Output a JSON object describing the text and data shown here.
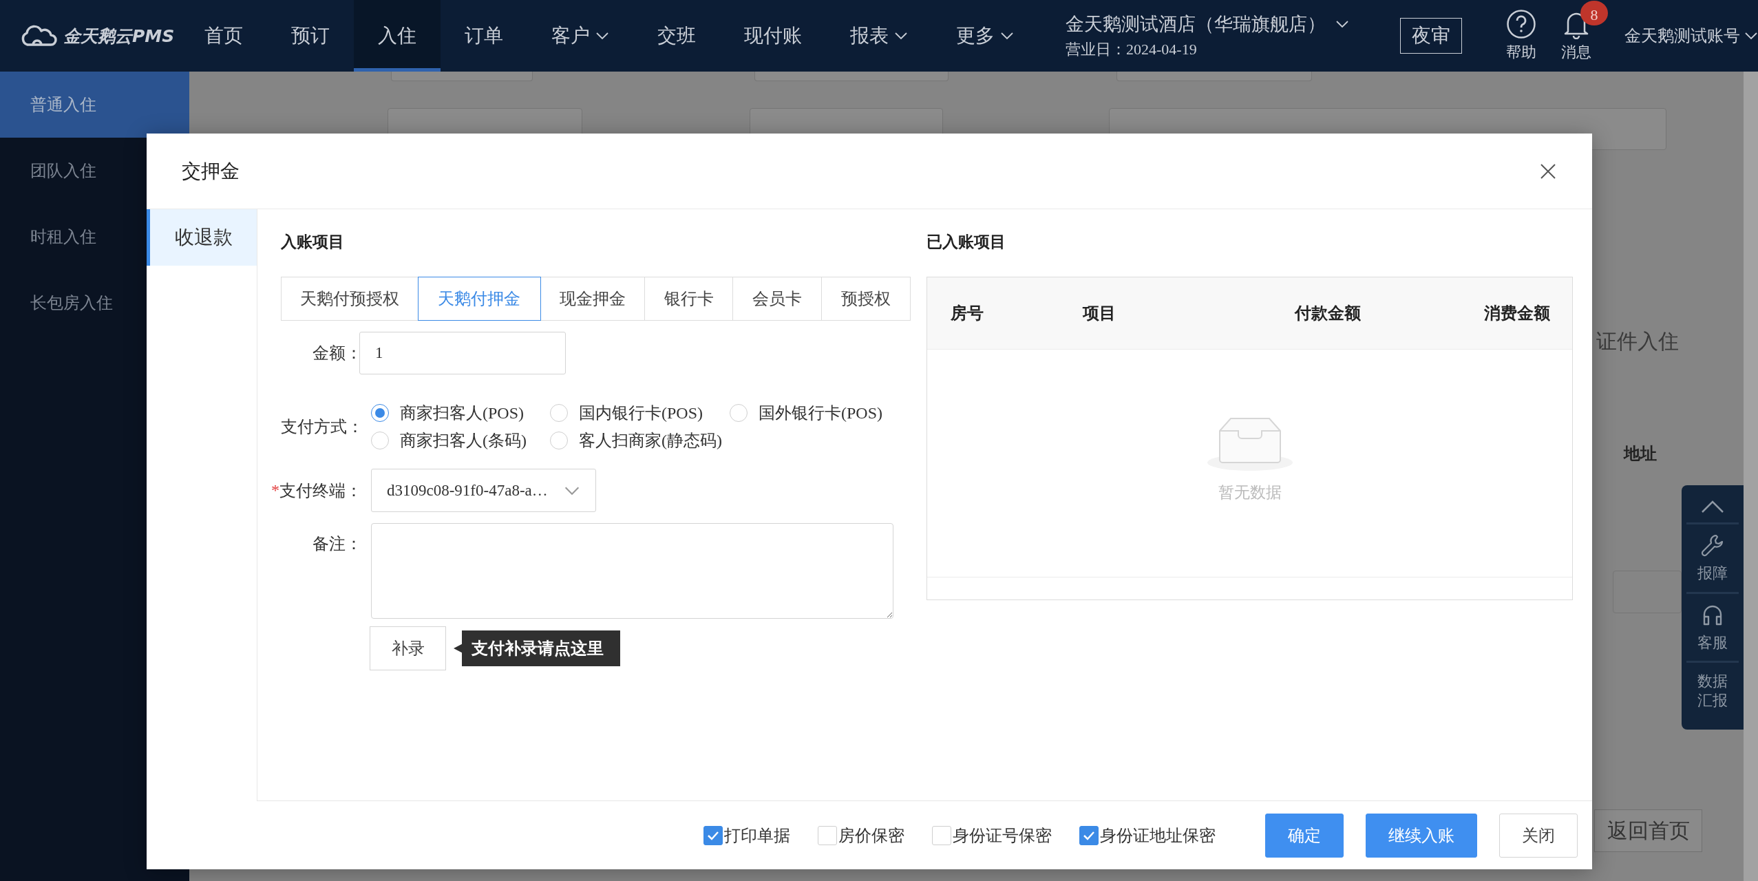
{
  "top_nav": {
    "logo_text": "金天鹅云PMS",
    "items": [
      {
        "label": "首页",
        "selected": false,
        "has_menu": false
      },
      {
        "label": "预订",
        "selected": false,
        "has_menu": false
      },
      {
        "label": "入住",
        "selected": true,
        "has_menu": false
      },
      {
        "label": "订单",
        "selected": false,
        "has_menu": false
      },
      {
        "label": "客户",
        "selected": false,
        "has_menu": true
      },
      {
        "label": "交班",
        "selected": false,
        "has_menu": false
      },
      {
        "label": "现付账",
        "selected": false,
        "has_menu": false
      },
      {
        "label": "报表",
        "selected": false,
        "has_menu": true
      },
      {
        "label": "更多",
        "selected": false,
        "has_menu": true
      }
    ],
    "hotel": {
      "name": "金天鹅测试酒店（华瑞旗舰店）",
      "business_day": "营业日：2024-04-19"
    },
    "night_audit_button": "夜审",
    "help_label": "帮助",
    "messages": {
      "label": "消息",
      "badge": "8"
    },
    "account": "金天鹅测试账号"
  },
  "sidebar": {
    "items": [
      {
        "label": "普通入住",
        "selected": true
      },
      {
        "label": "团队入住",
        "selected": false
      },
      {
        "label": "时租入住",
        "selected": false
      },
      {
        "label": "长包房入住",
        "selected": false
      }
    ]
  },
  "background_form": {
    "section_title": "证件入住",
    "column_header": "地址",
    "back_button": "返回首页"
  },
  "float_toolbar": {
    "items": [
      {
        "kind": "top"
      },
      {
        "kind": "repair",
        "label": "报障"
      },
      {
        "kind": "service",
        "label": "客服"
      },
      {
        "kind": "report",
        "label": "数据汇报"
      }
    ]
  },
  "dialog": {
    "title": "交押金",
    "nav": [
      {
        "label": "收退款",
        "selected": true
      }
    ],
    "entry": {
      "title": "入账项目",
      "tabs": [
        {
          "label": "天鹅付预授权",
          "selected": false
        },
        {
          "label": "天鹅付押金",
          "selected": true
        },
        {
          "label": "现金押金",
          "selected": false
        },
        {
          "label": "银行卡",
          "selected": false
        },
        {
          "label": "会员卡",
          "selected": false
        },
        {
          "label": "预授权",
          "selected": false
        }
      ],
      "amount": {
        "label": "金额：",
        "value": "1"
      },
      "payment_method": {
        "label": "支付方式：",
        "options": [
          {
            "label": "商家扫客人(POS)",
            "selected": true
          },
          {
            "label": "国内银行卡(POS)",
            "selected": false
          },
          {
            "label": "国外银行卡(POS)",
            "selected": false
          },
          {
            "label": "商家扫客人(条码)",
            "selected": false
          },
          {
            "label": "客人扫商家(静态码)",
            "selected": false
          }
        ]
      },
      "terminal": {
        "required_mark": "*",
        "label": "支付终端：",
        "value": "d3109c08-91f0-47a8-a…"
      },
      "remark": {
        "label": "备注："
      },
      "supplement_button": "补录",
      "tooltip": "支付补录请点这里"
    },
    "posted": {
      "title": "已入账项目",
      "columns": [
        "房号",
        "项目",
        "付款金额",
        "消费金额"
      ],
      "empty_text": "暂无数据"
    },
    "options": [
      {
        "label": "打印单据",
        "checked": true
      },
      {
        "label": "房价保密",
        "checked": false
      },
      {
        "label": "身份证号保密",
        "checked": false
      },
      {
        "label": "身份证地址保密",
        "checked": true
      }
    ],
    "buttons": [
      {
        "label": "确定",
        "kind": "primary"
      },
      {
        "label": "继续入账",
        "kind": "primary"
      },
      {
        "label": "关闭",
        "kind": "default"
      }
    ]
  }
}
